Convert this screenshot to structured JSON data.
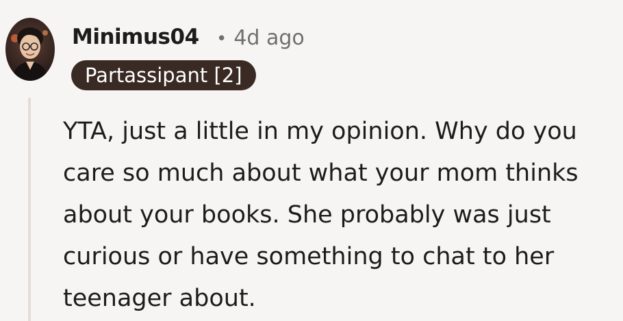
{
  "comment": {
    "author": "Minimus04",
    "separator": "•",
    "age": "4d ago",
    "flair": "Partassipant [2]",
    "avatar_icon": "user-avatar-icon",
    "body": "YTA, just a little in my opinion. Why do you care so much about what your mom thinks about your books. She probably was just curious or have something to chat to her teenager about."
  },
  "colors": {
    "background": "#f7f5f4",
    "flair_background": "#3a2a24",
    "thread_line": "#e3dcd8",
    "text": "#1c1c1c",
    "meta": "#6f6f6f"
  }
}
